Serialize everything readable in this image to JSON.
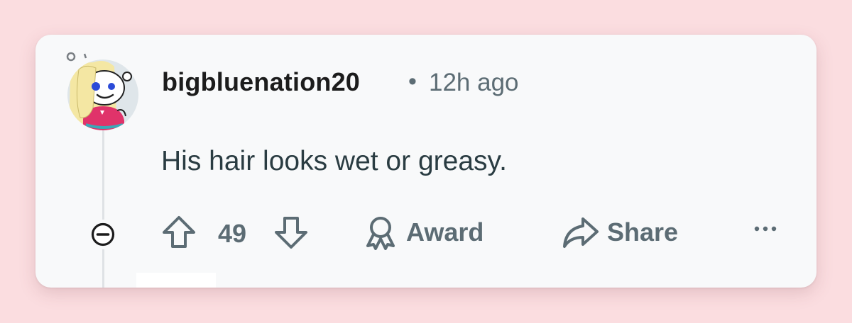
{
  "colors": {
    "page_background": "#fbdde0",
    "card_background": "#f8f9fa",
    "username": "#1c1c1c",
    "meta": "#5c6c74",
    "body_text": "#2a3c42"
  },
  "comment": {
    "username": "bigbluenation20",
    "separator": "•",
    "time_ago": "12h ago",
    "body": "His hair looks wet or greasy."
  },
  "actions": {
    "collapse_icon": "minus-circle-icon",
    "upvote_icon": "arrow-up-icon",
    "score": "49",
    "downvote_icon": "arrow-down-icon",
    "award_icon": "award-icon",
    "award_label": "Award",
    "share_icon": "share-arrow-icon",
    "share_label": "Share",
    "more_icon": "more-horizontal-icon"
  }
}
